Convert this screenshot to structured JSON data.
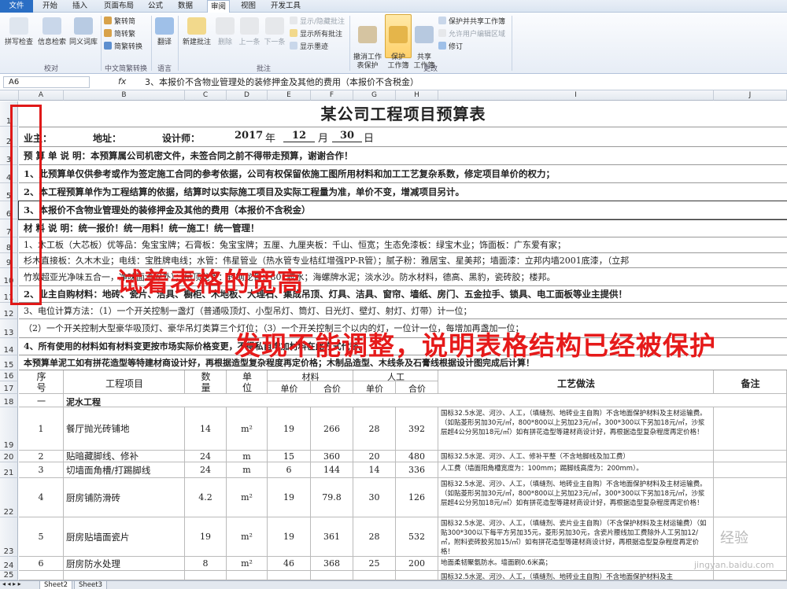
{
  "tabs": [
    "文件",
    "开始",
    "插入",
    "页面布局",
    "公式",
    "数据",
    "审阅",
    "视图",
    "开发工具"
  ],
  "ribbon": {
    "spell": "拼写检查",
    "info": "信息检索",
    "thesaurus": "同义词库",
    "trad_to_simp": "繁转简",
    "simp_to_trad": "简转繁",
    "convert": "简繁转换",
    "translate": "翻译",
    "new_comment": "新建批注",
    "delete": "删除",
    "prev": "上一条",
    "next": "下一条",
    "show_hide": "显示/隐藏批注",
    "show_all": "显示所有批注",
    "show_ink": "显示墨迹",
    "unprotect_sheet": "撤消工作\n表保护",
    "protect_workbook": "保护\n工作簿",
    "share_workbook": "共享\n工作簿",
    "protect_share": "保护并共享工作簿",
    "allow_edit": "允许用户编辑区域",
    "track": "修订",
    "groups": [
      "校对",
      "中文简繁转换",
      "语言",
      "批注",
      "更改"
    ]
  },
  "formula_bar": {
    "name_box": "A6",
    "fx": "fx",
    "content": "3、本报价不含物业管理处的装修押金及其他的费用（本报价不含税金）"
  },
  "columns": [
    "A",
    "B",
    "C",
    "D",
    "E",
    "F",
    "G",
    "H",
    "I",
    "J"
  ],
  "rows": [
    "1",
    "2",
    "3",
    "4",
    "5",
    "6",
    "7",
    "8",
    "9",
    "10",
    "11",
    "12",
    "13",
    "14",
    "15",
    "16",
    "17",
    "18",
    "19",
    "20",
    "21",
    "22",
    "23",
    "24",
    "25"
  ],
  "sheet": {
    "title": "某公司工程项目预算表",
    "owner": "业主：",
    "address": "地址：",
    "designer": "设计师：",
    "year": "2017",
    "year_unit": "年",
    "month": "12",
    "month_unit": "月",
    "day": "30",
    "day_unit": "日",
    "lines": [
      "预  算  单  说  明：本预算属公司机密文件，未签合同之前不得带走预算，谢谢合作！",
      "1、此预算单仅供参考或作为签定施工合同的参考依据，公司有权保留依施工图所用材料和加工工艺复杂系数，修定项目单价的权力；",
      "2、本工程预算单作为工程结算的依据，结算时以实际施工项目及实际工程量为准，单价不变，增减项目另计。",
      "3、本报价不含物业管理处的装修押金及其他的费用（本报价不含税金）",
      "材   料   说   明：统一报价！统一用料！统一施工！统一管理！",
      "1、木工板（大芯板）优等品：兔宝宝牌；石膏板：兔宝宝牌；五厘、九厘夹板：千山、恒宽；生态免漆板：绿宝木业；饰面板：广东爱有家；",
      "    杉木直接板：久木木业；电线：宝胜牌电线；水管：伟星管业（热水管专业桔红增强PP-R管）；腻子粉：雅居宝、星美邦；墙面漆：立邦内墙2001底漆，（立邦",
      "    竹炭超亚光净味五合一，净味面漆除外）；吊顶龙骨：轻钢龙骨；801胶水；海螺牌水泥；淡水沙。防水材料，德高、黑豹，瓷砖胶；楼邦。",
      "2、业主自购材料：地砖、瓷片、洁具、橱柜、木地板、大理石、集成吊顶、灯具、洁具、窗帘、墙纸、房门、五金拉手、锁具、电工面板等业主提供！",
      "3、电位计算方法：（1）一个开关控制一盏灯（普通吸顶灯、小型吊灯、筒灯、日光灯、壁灯、射灯、灯带）计一位；",
      "    （2）一个开关控制大型豪华吸顶灯、豪华吊灯类算三个灯位；（3）一个开关控制三个以内的灯，一位计一位，每增加再盏加一位；",
      "4、所有使用的材料如有材料变更按市场实际价格变更，不得私自增加材料在此方式代替。",
      "本预算单泥工如有拼花造型等特建材商设计好，再根据造型复杂程度再定价格；木制品造型、木线条及石膏线根据设计图完成后计算！"
    ],
    "table_header": {
      "seq": "序\n号",
      "project": "工程项目",
      "qty": "数\n量",
      "unit": "单\n位",
      "material": "材料",
      "labor": "人工",
      "unit_price": "单价",
      "total": "合价",
      "craft": "工艺做法",
      "remark": "备注"
    },
    "section": {
      "seq": "一",
      "name": "泥水工程"
    },
    "items": [
      {
        "seq": "1",
        "name": "餐厅抛光砖铺地",
        "qty": "14",
        "unit": "m²",
        "mat_price": "19",
        "mat_total": "266",
        "lab_price": "28",
        "lab_total": "392",
        "craft": "国标32.5水泥、河沙、人工，（填缝剂、地砖业主自购）不含地面保护材料及主材运输费。（如贴菱形另加30元/㎡，800*800以上另加23元/㎡，300*300以下另加18元/㎡，沙浆层超4公分另加18元/㎡）如有拼花造型等建材商设计好，再根据造型复杂程度再定价格！"
      },
      {
        "seq": "2",
        "name": "贴暗藏脚线、修补",
        "qty": "24",
        "unit": "m",
        "mat_price": "15",
        "mat_total": "360",
        "lab_price": "20",
        "lab_total": "480",
        "craft": "国标32.5水泥、河沙、人工、修补平整（不含地脚线及加工费）"
      },
      {
        "seq": "3",
        "name": "切墙面角槽/打踢脚线",
        "qty": "24",
        "unit": "m",
        "mat_price": "6",
        "mat_total": "144",
        "lab_price": "14",
        "lab_total": "336",
        "craft": "人工费（墙面阳角槽宽度为：100mm；踢脚线高度为：200mm）。"
      },
      {
        "seq": "4",
        "name": "厨房铺防滑砖",
        "qty": "4.2",
        "unit": "m²",
        "mat_price": "19",
        "mat_total": "79.8",
        "lab_price": "30",
        "lab_total": "126",
        "craft": "国标32.5水泥、河沙、人工，（填缝剂、地砖业主自购）不含地面保护材料及主材运输费。（如贴菱形另加30元/㎡，800*800以上另加23元/㎡，300*300以下另加18元/㎡，沙浆层超4公分另加18元/㎡）如有拼花造型等建材商设计好，再根据造型复杂程度再定价格！"
      },
      {
        "seq": "5",
        "name": "厨房贴墙面瓷片",
        "qty": "19",
        "unit": "m²",
        "mat_price": "19",
        "mat_total": "361",
        "lab_price": "28",
        "lab_total": "532",
        "craft": "国标32.5水泥、河沙、人工，（填缝剂、瓷片业主自购）（不含保护材料及主材运输费）（如贴300*300以下每平方另加35元，菱形另加30元，含瓷片腰线加工费除外人工另加12/㎡，附料瓷砖胶另加15/㎡）如有拼花造型等建材商设计好，再根据造型复杂程度再定价格！"
      },
      {
        "seq": "6",
        "name": "厨房防水处理",
        "qty": "8",
        "unit": "m²",
        "mat_price": "46",
        "mat_total": "368",
        "lab_price": "25",
        "lab_total": "200",
        "craft": "地面柔韧聚氨防水。墙面刷0.6米高；"
      },
      {
        "seq": "",
        "name": "",
        "qty": "",
        "unit": "",
        "mat_price": "",
        "mat_total": "",
        "lab_price": "",
        "lab_total": "",
        "craft": "国标32.5水泥、河沙、人工，（填缝剂、地砖业主自购）不含地面保护材料及主"
      }
    ]
  },
  "annotations": {
    "line1": "试着表格的宽高",
    "line2": "发现不能调整，说明表格结构已经被保护"
  },
  "sheet_tabs": [
    "Sheet2",
    "Sheet3"
  ],
  "watermark": {
    "site": "jingyan.baidu.com",
    "brand": "经验"
  }
}
